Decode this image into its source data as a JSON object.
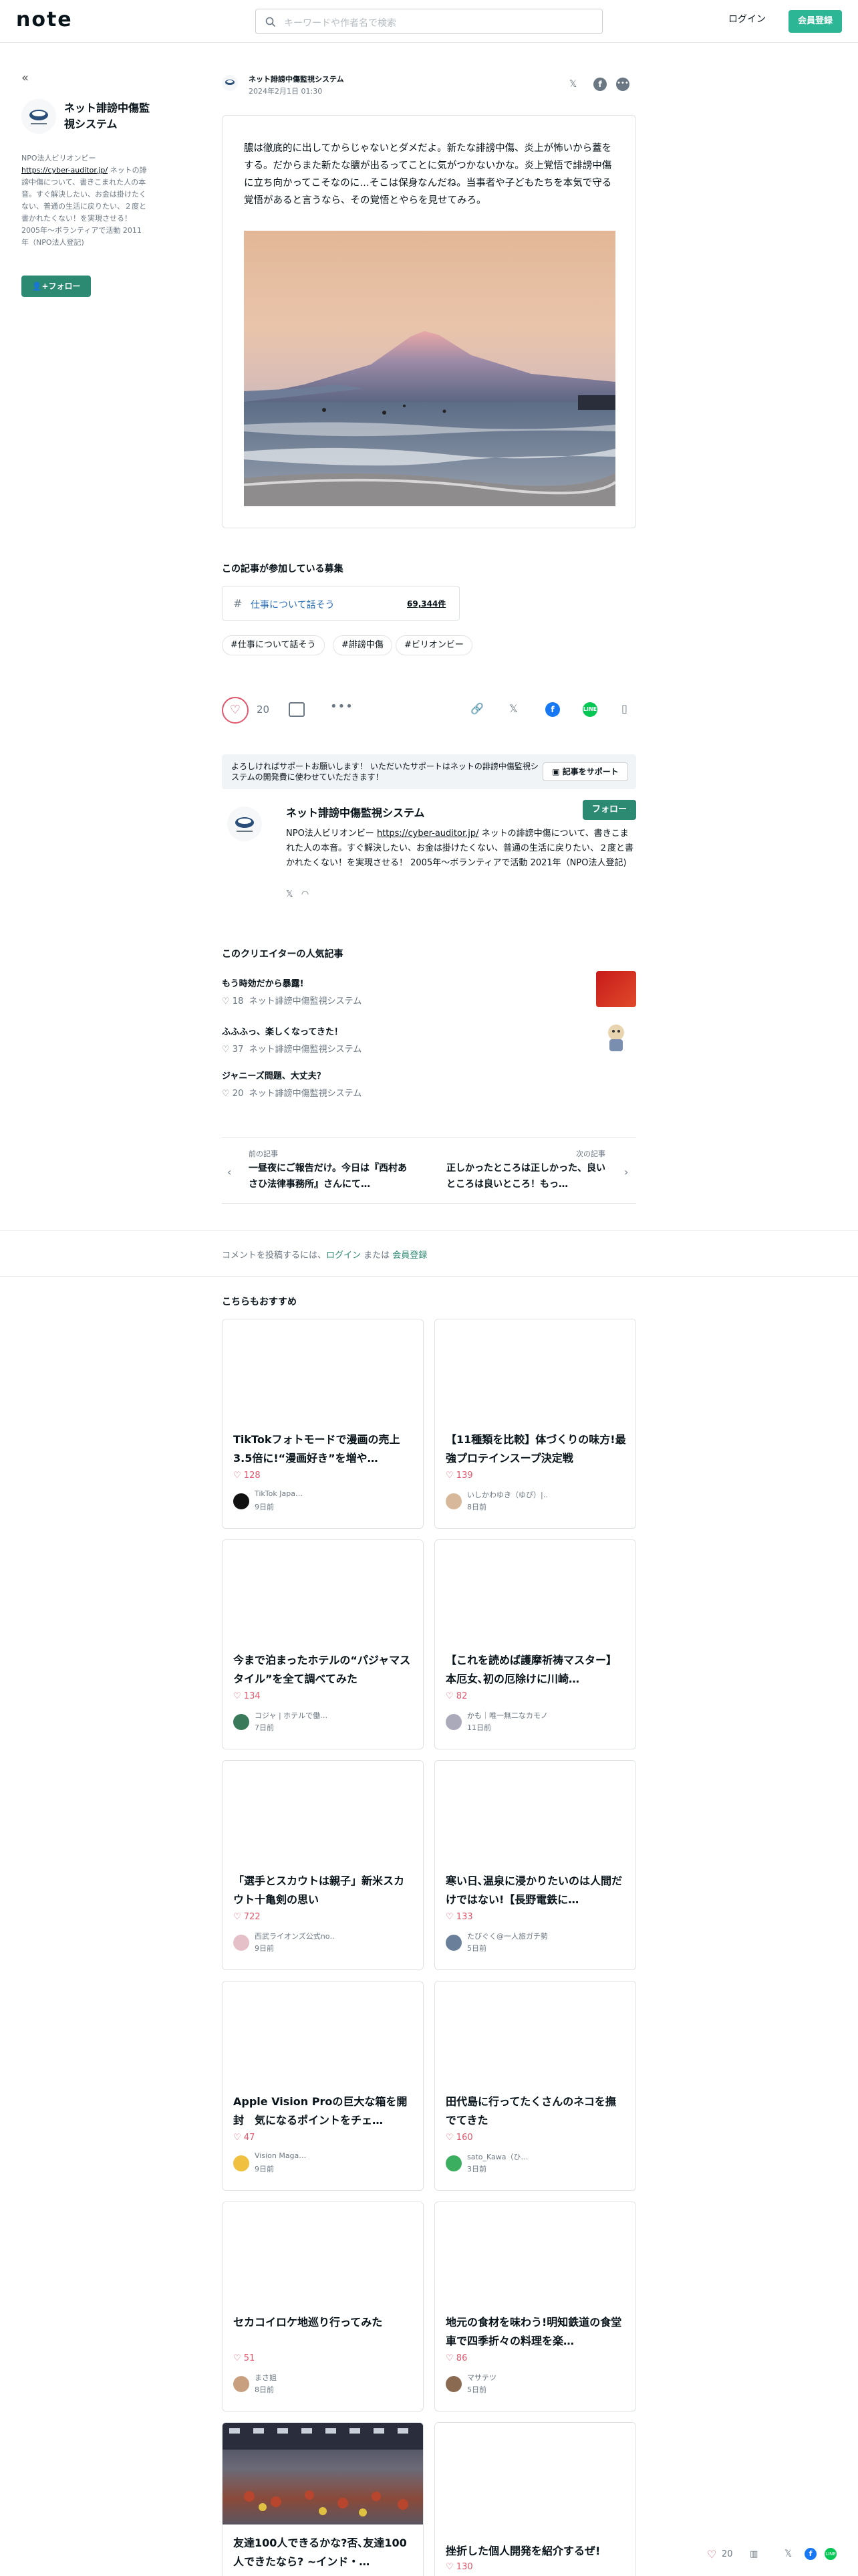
{
  "header": {
    "logo": "note",
    "search_placeholder": "キーワードや作者名で検索",
    "login": "ログイン",
    "register": "会員登録"
  },
  "sidebar": {
    "back": "«",
    "name": "ネット誹謗中傷監視システム",
    "desc_prefix": "NPO法人ビリオンビー",
    "desc_link": "https://cyber-auditor.jp/",
    "desc_rest": " ネットの誹謗中傷について、書きこまれた人の本音。すぐ解決したい、お金は掛けたくない、普通の生活に戻りたい、２度と書かれたくない！を実現させる！ 2005年〜ボランティアで活動 2011年（NPO法人登記)",
    "follow": "フォロー"
  },
  "article": {
    "author": "ネット誹謗中傷監視システム",
    "date": "2024年2月1日 01:30",
    "text": "膿は徹底的に出してからじゃないとダメだよ。新たな誹謗中傷、炎上が怖いから蓋をする。だからまた新たな膿が出るってことに気がつかないかな。炎上覚悟で誹謗中傷に立ち向かってこそなのに…そこは保身なんだね。当事者や子どもたちを本気で守る覚悟があると言うなら、その覚悟とやらを見せてみろ。"
  },
  "contest": {
    "title": "この記事が参加している募集",
    "name": "仕事について話そう",
    "count": "69,344件"
  },
  "tags": [
    "#仕事について話そう",
    "#誹謗中傷",
    "#ビリオンビー"
  ],
  "actions": {
    "likes": "20"
  },
  "support": {
    "text": "よろしければサポートお願いします！ いただいたサポートはネットの誹謗中傷監視システムの開発費に使わせていただきます！",
    "button": "記事をサポート"
  },
  "creator": {
    "name": "ネット誹謗中傷監視システム",
    "follow": "フォロー",
    "desc_prefix": "NPO法人ビリオンビー ",
    "desc_link": "https://cyber-auditor.jp/",
    "desc_rest": " ネットの誹謗中傷について、書きこまれた人の本音。すぐ解決したい、お金は掛けたくない、普通の生活に戻りたい、２度と書かれたくない！を実現させる！ 2005年〜ボランティアで活動 2021年（NPO法人登記)"
  },
  "popular": {
    "title": "このクリエイターの人気記事",
    "items": [
      {
        "title": "もう時効だから暴露!",
        "likes": "18",
        "author": "ネット誹謗中傷監視システム"
      },
      {
        "title": "ふふふっ、楽しくなってきた！",
        "likes": "37",
        "author": "ネット誹謗中傷監視システム"
      },
      {
        "title": "ジャニーズ問題、大丈夫？",
        "likes": "20",
        "author": "ネット誹謗中傷監視システム"
      }
    ]
  },
  "nav": {
    "prev_label": "前の記事",
    "prev_title": "一昼夜にご報告だけ。今日は『西村あさひ法律事務所』さんにて…",
    "next_label": "次の記事",
    "next_title": "正しかったところは正しかった、良いところは良いところ！もっ…"
  },
  "comment": {
    "prefix": "コメントを投稿するには、",
    "login": "ログイン",
    "or": " または ",
    "register": "会員登録"
  },
  "recommend": {
    "title": "こちらもおすすめ",
    "cards": [
      {
        "title": "TikTokフォトモードで漫画の売上3.5倍に!“漫画好き”を増や…",
        "likes": "128",
        "author": "TikTok Japa…",
        "ago": "9日前"
      },
      {
        "title": "【11種類を比較】体づくりの味方!最強プロテインスープ決定戦",
        "likes": "139",
        "author": "いしかわゆき（ゆぴ）|…",
        "ago": "8日前"
      },
      {
        "title": "今まで泊まったホテルの“パジャマスタイル”を全て調べてみた",
        "likes": "134",
        "author": "コジャ | ホテルで働…",
        "ago": "7日前"
      },
      {
        "title": "【これを読めば護摩祈祷マスター】本厄女､初の厄除けに川崎…",
        "likes": "82",
        "author": "かも｜唯一無二なカモノ…",
        "ago": "11日前"
      },
      {
        "title": "「選手とスカウトは親子」新米スカウト十亀剣の思い",
        "likes": "722",
        "author": "西武ライオンズ公式no…",
        "ago": "9日前"
      },
      {
        "title": "寒い日､温泉に浸かりたいのは人間だけではない!【長野電鉄に…",
        "likes": "133",
        "author": "たびぐく@一人旅ガチ勢",
        "ago": "5日前"
      },
      {
        "title": "Apple Vision Proの巨大な箱を開封　気になるポイントをチェ…",
        "likes": "47",
        "author": "Vision Maga…",
        "ago": "9日前"
      },
      {
        "title": "田代島に行ってたくさんのネコを撫でてきた",
        "likes": "160",
        "author": "sato_Kawa（ひ…",
        "ago": "3日前"
      },
      {
        "title": "セカコイロケ地巡り行ってみた",
        "likes": "51",
        "author": "まさ姐",
        "ago": "8日前"
      },
      {
        "title": "地元の食材を味わう!明知鉄道の食堂車で四季折々の料理を楽…",
        "likes": "86",
        "author": "マサテツ",
        "ago": "5日前"
      },
      {
        "title": "友達100人できるかな?否､友達100人できたなら? ~インド・…",
        "likes": "",
        "author": "",
        "ago": ""
      },
      {
        "title": "挫折した個人開発を紹介するぜ!",
        "likes": "130",
        "author": "",
        "ago": ""
      }
    ]
  },
  "floating": {
    "likes": "20"
  },
  "colors": {
    "accent": "#2cb696",
    "follow": "#2d8a72",
    "like": "#e0576d"
  }
}
